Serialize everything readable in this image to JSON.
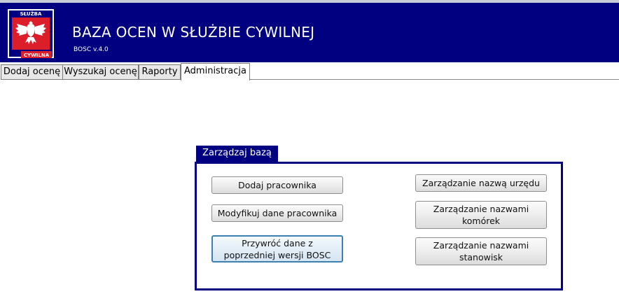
{
  "header": {
    "title": "BAZA OCEN W SŁUŻBIE CYWILNEJ",
    "version": "BOSC v.4.0",
    "logo": {
      "top_text": "SŁUŻBA",
      "bottom_text": "CYWILNA",
      "colors": {
        "red": "#dc1e2a",
        "white": "#ffffff",
        "border": "#ffffff"
      }
    }
  },
  "tabs": [
    {
      "label": "Dodaj ocenę",
      "active": false
    },
    {
      "label": "Wyszukaj ocenę",
      "active": false
    },
    {
      "label": "Raporty",
      "active": false
    },
    {
      "label": "Administracja",
      "active": true
    }
  ],
  "group": {
    "title": "Zarządzaj bazą",
    "buttons_left": [
      {
        "label": "Dodaj pracownika"
      },
      {
        "label": "Modyfikuj dane pracownika"
      },
      {
        "label": "Przywróć dane z poprzedniej wersji BOSC",
        "focused": true
      }
    ],
    "buttons_right": [
      {
        "label": "Zarządzanie nazwą urzędu"
      },
      {
        "label": "Zarządzanie nazwami komórek"
      },
      {
        "label": "Zarządzanie nazwami stanowisk"
      }
    ]
  },
  "colors": {
    "header_bg": "#000080",
    "accent": "#000080",
    "focus_border": "#3c7fb1"
  }
}
